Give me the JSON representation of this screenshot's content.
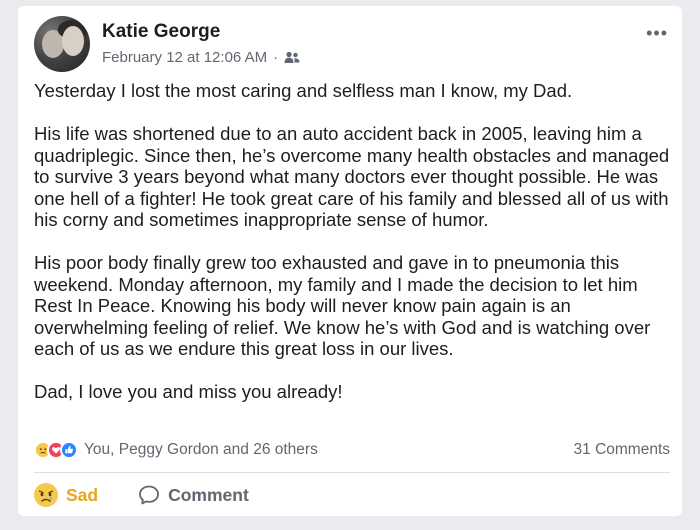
{
  "post": {
    "author": "Katie George",
    "timestamp": "February 12 at 12:06 AM",
    "separator": "·",
    "audience_icon": "friends-icon",
    "paragraphs": [
      "Yesterday I lost the most caring and selfless man I know, my Dad.",
      "His life was shortened due to an auto accident back in 2005, leaving him a quadriplegic. Since then, he’s overcome many health obstacles and managed to survive 3 years beyond what many doctors ever thought possible. He was one hell of a fighter! He took great care of his family and blessed all of us with his corny and sometimes inappropriate sense of humor.",
      "His poor body finally grew too exhausted and gave in to pneumonia this weekend. Monday afternoon, my family and I made the decision to let him Rest In Peace. Knowing his body will never know pain again is an overwhelming feeling of relief. We know he’s with God and is watching over each of us as we endure this great loss in our lives.",
      "Dad, I love you and miss you already!"
    ]
  },
  "reactions": {
    "icons": [
      "sad-reaction-icon",
      "love-reaction-icon",
      "like-reaction-icon"
    ],
    "summary": "You, Peggy Gordon and 26 others",
    "comments": "31 Comments"
  },
  "actions": {
    "sad_label": "Sad",
    "comment_label": "Comment"
  },
  "colors": {
    "background": "#e9ebee",
    "card": "#ffffff",
    "secondary_text": "#606770",
    "sad_yellow": "#e4a620",
    "love_red": "#f2415a",
    "like_blue": "#2d88ff"
  }
}
